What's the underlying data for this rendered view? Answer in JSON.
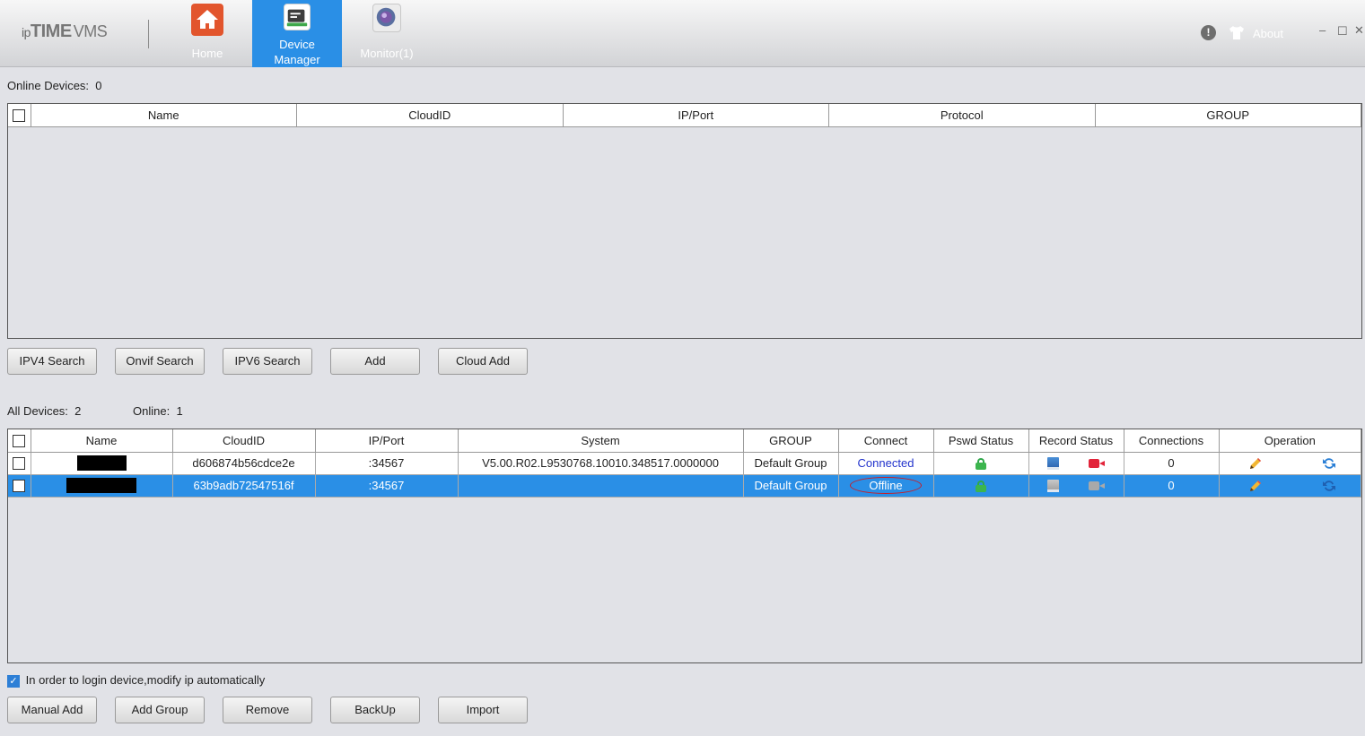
{
  "app": {
    "logo_ip": "ip",
    "logo_time": "TIME",
    "logo_vms": "VMS",
    "about": "About"
  },
  "nav": [
    {
      "label": "Home",
      "icon": "home-icon"
    },
    {
      "label": "Device\nManager",
      "label_line1": "Device",
      "label_line2": "Manager",
      "icon": "device-manager-icon",
      "active": true
    },
    {
      "label": "Monitor(1)",
      "icon": "monitor-icon"
    }
  ],
  "window_controls": {
    "minimize": "–",
    "maximize": "☐",
    "close": "✕"
  },
  "online_section": {
    "label": "Online Devices:",
    "count": "0",
    "columns": [
      "Name",
      "CloudID",
      "IP/Port",
      "Protocol",
      "GROUP"
    ],
    "rows": []
  },
  "search_buttons": {
    "ipv4": "IPV4 Search",
    "onvif": "Onvif Search",
    "ipv6": "IPV6 Search",
    "add": "Add",
    "cloud_add": "Cloud Add"
  },
  "all_section": {
    "label": "All Devices:",
    "count": "2",
    "online_label": "Online:",
    "online_count": "1",
    "columns": [
      "Name",
      "CloudID",
      "IP/Port",
      "System",
      "GROUP",
      "Connect",
      "Pswd Status",
      "Record Status",
      "Connections",
      "Operation"
    ],
    "rows": [
      {
        "cloud_id": "d606874b56cdce2e",
        "ip_port": ":34567",
        "system": "V5.00.R02.L9530768.10010.348517.0000000",
        "group": "Default Group",
        "connect": "Connected",
        "connections": "0",
        "selected": false
      },
      {
        "cloud_id": "63b9adb72547516f",
        "ip_port": ":34567",
        "system": "",
        "group": "Default Group",
        "connect": "Offline",
        "connections": "0",
        "selected": true
      }
    ]
  },
  "auto_ip": {
    "label": "In order to login device,modify ip automatically",
    "checked": true
  },
  "bottom_buttons": {
    "manual_add": "Manual Add",
    "add_group": "Add Group",
    "remove": "Remove",
    "backup": "BackUp",
    "import": "Import"
  },
  "colors": {
    "accent": "#2a8fe6",
    "home_icon": "#e2552d",
    "connected": "#2233cc",
    "offline_ring": "#c81d25"
  }
}
